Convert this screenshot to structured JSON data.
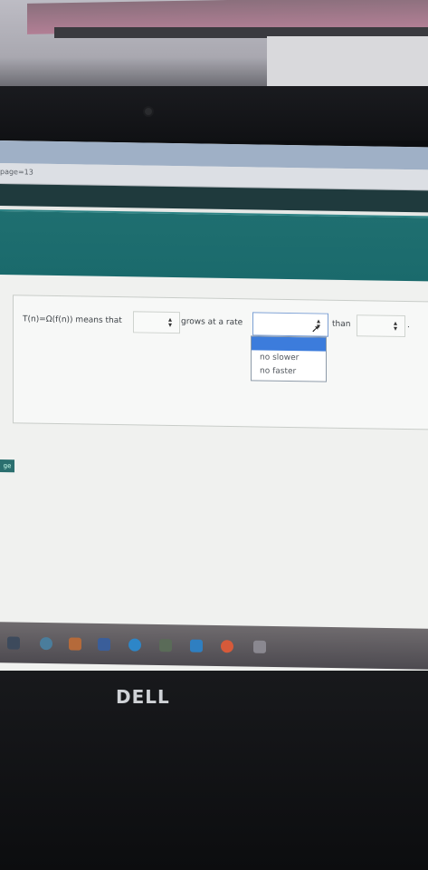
{
  "browser": {
    "address_fragment": "page=13"
  },
  "question": {
    "part1": "T(n)=Ω(f(n)) means that",
    "part2": "grows at a rate",
    "part3": "than",
    "period": "."
  },
  "dropdown": {
    "options": [
      "no slower",
      "no faster"
    ]
  },
  "nav": {
    "continue_fragment": "ge"
  },
  "device": {
    "brand": "DELL"
  },
  "colors": {
    "teal_band": "#1a6a6c",
    "dropdown_highlight": "#3c7cdc"
  }
}
